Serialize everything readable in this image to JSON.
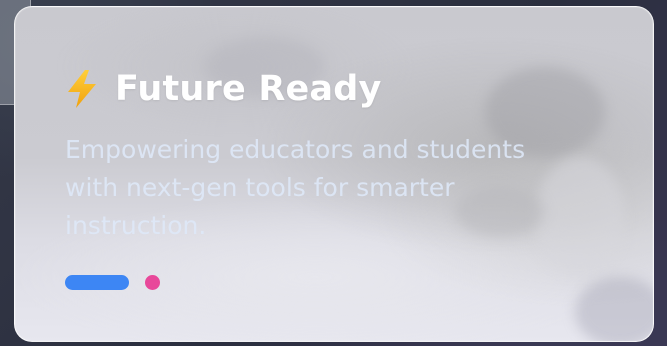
{
  "card": {
    "icon": "lightning-bolt-icon",
    "title": "Future Ready",
    "description": "Empowering educators and students with next-gen tools for smarter instruction."
  },
  "indicators": {
    "count": 2,
    "active_index": 0,
    "active_color": "#3d86f4",
    "inactive_color": "#e8489a"
  },
  "colors": {
    "icon_color": "#f5b51c",
    "title_color": "#ffffff"
  }
}
